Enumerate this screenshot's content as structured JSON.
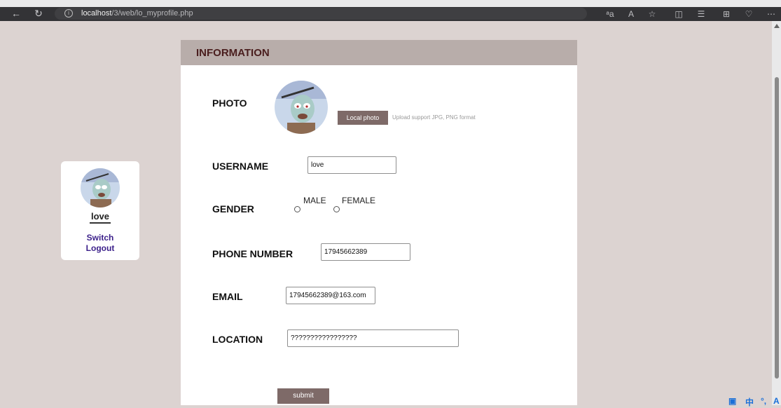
{
  "browser": {
    "url_host": "localhost",
    "url_path": "/3/web/lo_myprofile.php",
    "icons": [
      "back-icon",
      "refresh-icon",
      "read-aloud-icon",
      "text-size-icon",
      "favorite-icon",
      "split-screen-icon",
      "favorites-list-icon",
      "collections-icon",
      "extensions-icon",
      "more-icon"
    ]
  },
  "user_card": {
    "name": "love",
    "switch_label": "Switch",
    "logout_label": "Logout"
  },
  "panel": {
    "title": "INFORMATION",
    "photo_label": "PHOTO",
    "upload_button": "Local photo",
    "upload_hint": "Upload support JPG, PNG format",
    "username_label": "USERNAME",
    "username_value": "love",
    "gender_label": "GENDER",
    "gender_male": "MALE",
    "gender_female": "FEMALE",
    "phone_label": "PHONE NUMBER",
    "phone_value": "17945662389",
    "email_label": "EMAIL",
    "email_value": "17945662389@163.com",
    "location_label": "LOCATION",
    "location_value": "?????????????????",
    "submit_label": "submit"
  },
  "colors": {
    "page_bg": "#dcd3d1",
    "header_bg": "#b8adaa",
    "header_text": "#4a1e1e",
    "button_bg": "#7e6a68",
    "link": "#3b1f8a"
  }
}
